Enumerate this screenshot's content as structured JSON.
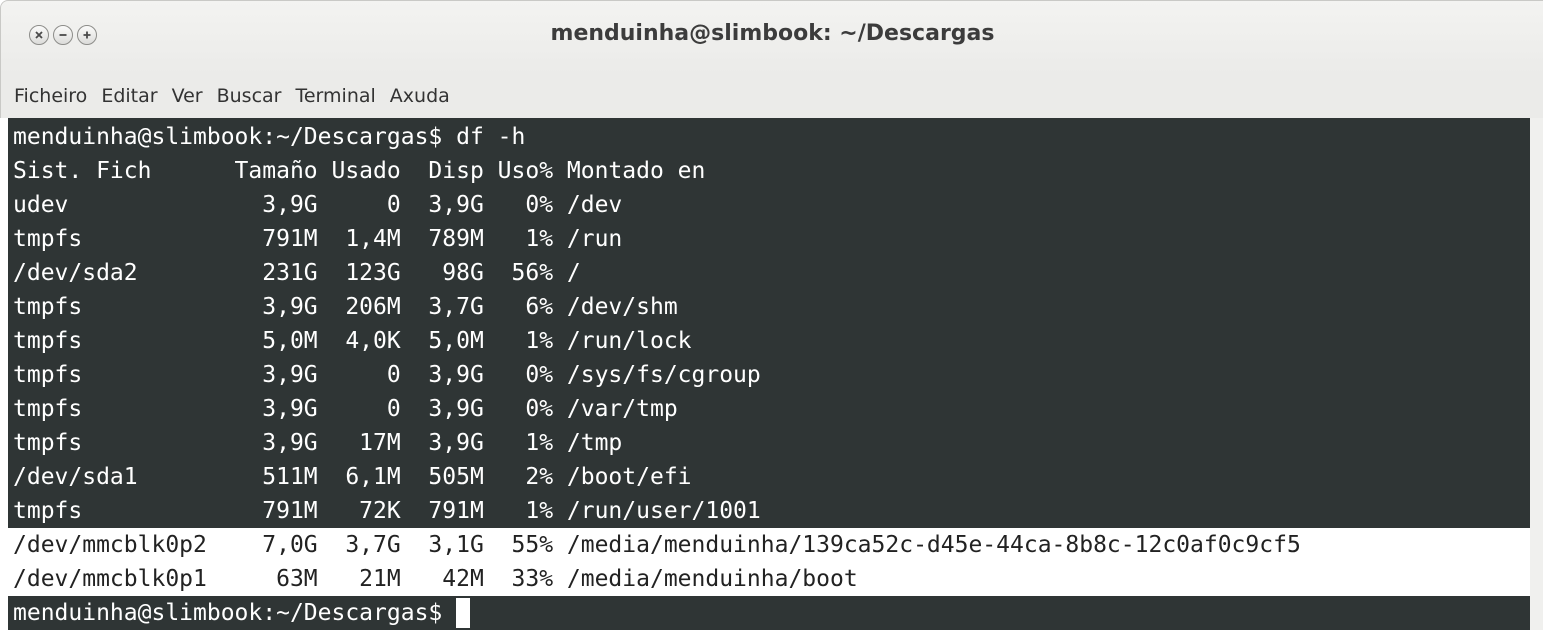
{
  "window": {
    "title": "menduinha@slimbook: ~/Descargas",
    "buttons": [
      "close-icon",
      "minimize-icon",
      "maximize-icon"
    ]
  },
  "menu": [
    "Ficheiro",
    "Editar",
    "Ver",
    "Buscar",
    "Terminal",
    "Axuda"
  ],
  "terminal": {
    "lines": [
      "menduinha@slimbook:~/Descargas$ df -h",
      "Sist. Fich      Tamaño Usado  Disp Uso% Montado en",
      "udev              3,9G     0  3,9G   0% /dev",
      "tmpfs             791M  1,4M  789M   1% /run",
      "/dev/sda2         231G  123G   98G  56% /",
      "tmpfs             3,9G  206M  3,7G   6% /dev/shm",
      "tmpfs             5,0M  4,0K  5,0M   1% /run/lock",
      "tmpfs             3,9G     0  3,9G   0% /sys/fs/cgroup",
      "tmpfs             3,9G     0  3,9G   0% /var/tmp",
      "tmpfs             3,9G   17M  3,9G   1% /tmp",
      "/dev/sda1         511M  6,1M  505M   2% /boot/efi",
      "tmpfs             791M   72K  791M   1% /run/user/1001",
      "/dev/mmcblk0p2    7,0G  3,7G  3,1G  55% /media/menduinha/139ca52c-d45e-44ca-8b8c-12c0af0c9cf5",
      "/dev/mmcblk0p1     63M   21M   42M  33% /media/menduinha/boot",
      "menduinha@slimbook:~/Descargas$ "
    ],
    "selected_lines": [
      12,
      13
    ]
  },
  "colors": {
    "terminal_bg": "#2f3535",
    "terminal_fg": "#ffffff",
    "selection_bg": "#ffffff",
    "selection_fg": "#222222"
  }
}
